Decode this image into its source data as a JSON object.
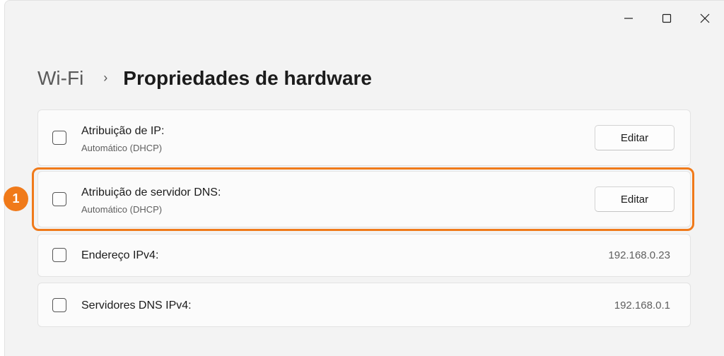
{
  "window_controls": {
    "minimize_icon": "minimize-icon",
    "maximize_icon": "maximize-icon",
    "close_icon": "close-icon"
  },
  "breadcrumb": {
    "parent": "Wi-Fi",
    "separator": "›",
    "current": "Propriedades de hardware"
  },
  "rows": [
    {
      "title": "Atribuição de IP:",
      "subtitle": "Automático (DHCP)",
      "button": "Editar"
    },
    {
      "title": "Atribuição de servidor DNS:",
      "subtitle": "Automático (DHCP)",
      "button": "Editar"
    },
    {
      "title": "Endereço IPv4:",
      "value": "192.168.0.23"
    },
    {
      "title": "Servidores DNS IPv4:",
      "value": "192.168.0.1"
    }
  ],
  "annotation": {
    "badge": "1",
    "color": "#f07a1a"
  },
  "colors": {
    "window_bg": "#f3f3f3",
    "card_bg": "#fbfbfb",
    "accent": "#f07a1a"
  }
}
